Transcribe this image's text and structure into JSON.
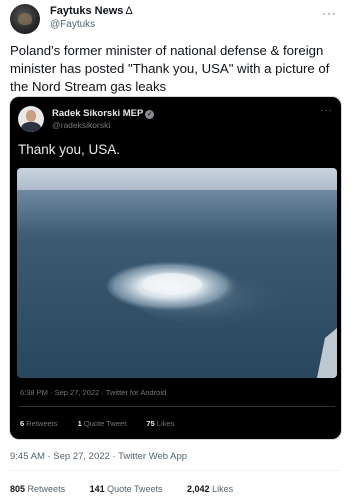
{
  "tweet": {
    "author_name": "Faytuks News",
    "author_flag": "Δ",
    "author_handle": "@Faytuks",
    "more": "···",
    "text": "Poland's former minister of national defense & foreign minister has posted \"Thank you, USA\" with a picture of the Nord Stream gas leaks",
    "timestamp": "9:45 AM · Sep 27, 2022 · Twitter Web App",
    "stats": {
      "retweets_count": "805",
      "retweets_label": "Retweets",
      "quotes_count": "141",
      "quotes_label": "Quote Tweets",
      "likes_count": "2,042",
      "likes_label": "Likes"
    }
  },
  "quoted": {
    "author_name": "Radek Sikorski MEP",
    "verified": "✓",
    "author_handle": "@radeksikorski",
    "more": "···",
    "text": "Thank you, USA.",
    "meta": "6:38 PM · Sep 27, 2022 · Twitter for Android",
    "stats": {
      "retweets_count": "6",
      "retweets_label": "Retweets",
      "quotes_count": "1",
      "quotes_label": "Quote Tweet",
      "likes_count": "75",
      "likes_label": "Likes"
    }
  },
  "icons": {
    "more": "more-horizontal-icon",
    "verified": "verified-badge-icon"
  },
  "colors": {
    "text_primary": "#0f1419",
    "text_secondary": "#536471",
    "card_bg": "#000000",
    "sea": "#2e4f66"
  }
}
